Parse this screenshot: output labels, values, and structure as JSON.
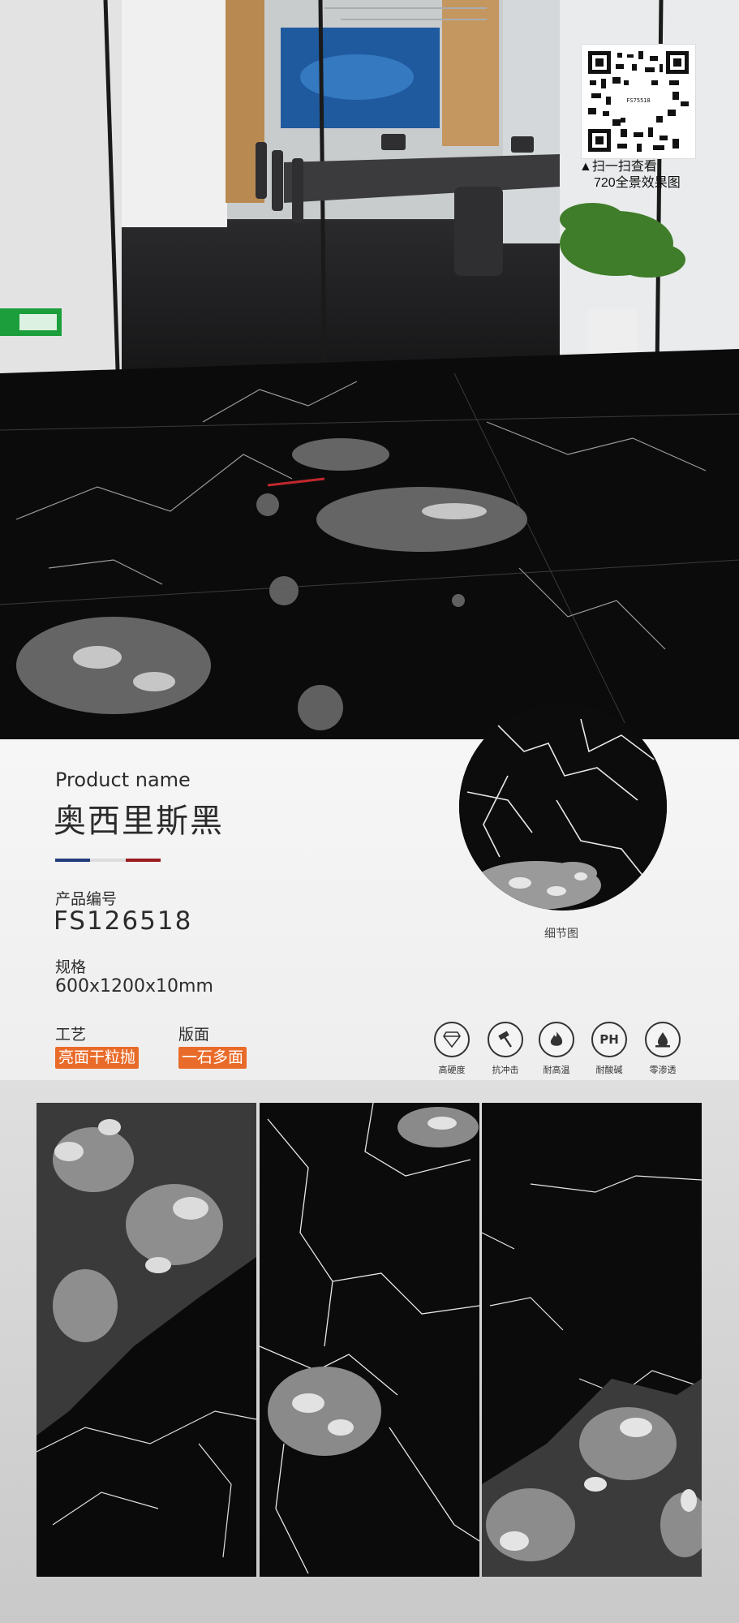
{
  "qr": {
    "code_text": "FS75518",
    "caption_line1": "▲扫一扫查看",
    "caption_line2": "720全景效果图"
  },
  "product": {
    "label": "Product name",
    "name": "奥西里斯黑",
    "code_label": "产品编号",
    "code": "FS126518",
    "spec_label": "规格",
    "spec": "600x1200x10mm",
    "craft_label": "工艺",
    "craft": "亮面干粒抛",
    "face_label": "版面",
    "face": "一石多面"
  },
  "detail": {
    "caption": "细节图"
  },
  "divider_colors": [
    "#1f3b7a",
    "#dcdcdc",
    "#9b1b1f"
  ],
  "accent_color": "#e96b2a",
  "features": [
    {
      "icon": "diamond-icon",
      "label": "高硬度"
    },
    {
      "icon": "hammer-icon",
      "label": "抗冲击"
    },
    {
      "icon": "flame-icon",
      "label": "耐高温"
    },
    {
      "icon": "ph-icon",
      "label": "耐酸碱",
      "symbol": "PH"
    },
    {
      "icon": "water-drop-icon",
      "label": "零渗透"
    }
  ]
}
